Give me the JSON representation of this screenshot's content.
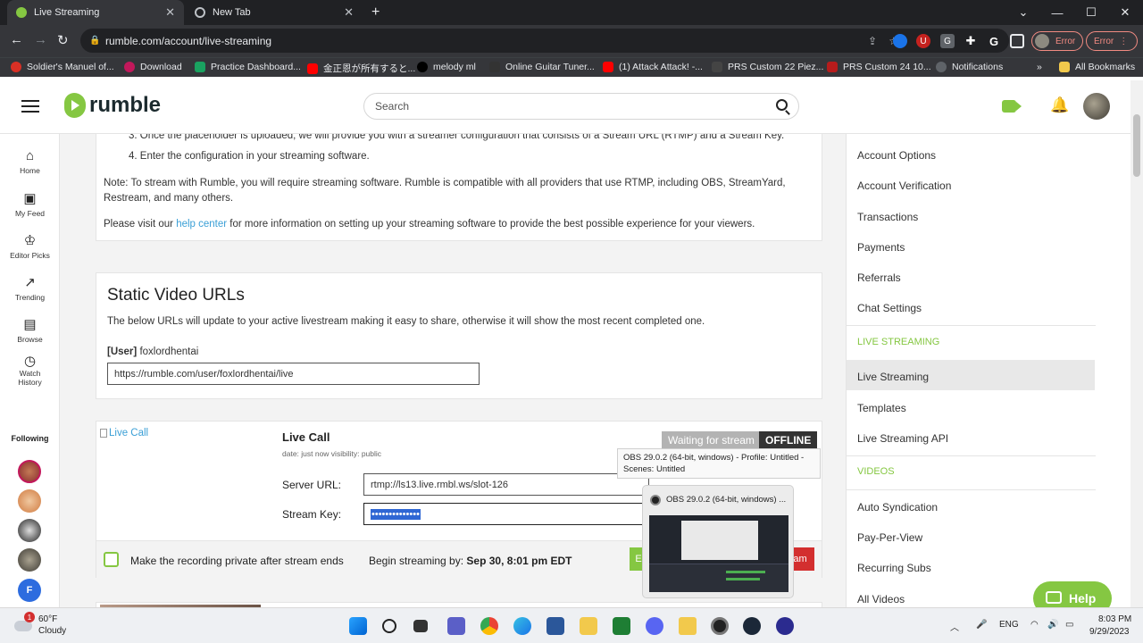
{
  "browser": {
    "tabs": [
      {
        "title": "Live Streaming"
      },
      {
        "title": "New Tab"
      }
    ],
    "new_tab_symbol": "+",
    "close_symbol": "✕",
    "url": "rumble.com/account/live-streaming",
    "extensions": {
      "error_label": "Error",
      "error_pill": "Error"
    },
    "bookmarks": [
      {
        "label": "Soldier's Manuel of...",
        "color": "#d93025"
      },
      {
        "label": "Download",
        "color": "#c2185b"
      },
      {
        "label": "Practice Dashboard...",
        "color": "#1aa260"
      },
      {
        "label": "金正恩が所有すると...",
        "color": "#ff0000"
      },
      {
        "label": "melody ml",
        "color": "#000000"
      },
      {
        "label": "Online Guitar Tuner...",
        "color": "#333333"
      },
      {
        "label": "(1) Attack Attack! -...",
        "color": "#ff0000"
      },
      {
        "label": "PRS Custom 22 Piez...",
        "color": "#444444"
      },
      {
        "label": "PRS Custom 24 10...",
        "color": "#b71c1c"
      },
      {
        "label": "Notifications",
        "color": "#5f6368"
      }
    ],
    "bookmarks_overflow": "»",
    "all_bookmarks": "All Bookmarks"
  },
  "site": {
    "logo_text": "rumble",
    "search_placeholder": "Search",
    "brand_color": "#85c742"
  },
  "leftnav": {
    "items": [
      {
        "label": "Home",
        "icon": "home-icon",
        "glyph": "⌂"
      },
      {
        "label": "My Feed",
        "icon": "feed-icon",
        "glyph": "▣"
      },
      {
        "label": "Editor Picks",
        "icon": "award-icon",
        "glyph": "♔"
      },
      {
        "label": "Trending",
        "icon": "trending-icon",
        "glyph": "↗"
      },
      {
        "label": "Browse",
        "icon": "browse-icon",
        "glyph": "▤"
      },
      {
        "label": "Watch History",
        "icon": "history-icon",
        "glyph": "◷"
      }
    ],
    "following_label": "Following",
    "following_letter": "F"
  },
  "content": {
    "steps": [
      "3. Once the placeholder is uploaded, we will provide you with a streamer configuration that consists of a Stream URL (RTMP) and a Stream Key.",
      "4. Enter the configuration in your streaming software."
    ],
    "note": "Note: To stream with Rumble, you will require streaming software. Rumble is compatible with all providers that use RTMP, including OBS, StreamYard, Restream, and many others.",
    "visit_prefix": "Please visit our ",
    "visit_link": "help center",
    "visit_suffix": " for more information on setting up your streaming software to provide the best possible experience for your viewers.",
    "static_title": "Static Video URLs",
    "static_desc": "The below URLs will update to your active livestream making it easy to share, otherwise it will show the most recent completed one.",
    "user_tag": "[User]",
    "user_name": "foxlordhentai",
    "user_url": "https://rumble.com/user/foxlordhentai/live",
    "live_call": {
      "thumb_alt": "Live Call",
      "title": "Live Call",
      "meta": "date: just now  visibility: public",
      "waiting": "Waiting for stream",
      "offline": "OFFLINE",
      "server_label": "Server URL:",
      "server_value": "rtmp://ls13.live.rmbl.ws/slot-126",
      "key_label": "Stream Key:",
      "key_value": "••••••••••••••",
      "private_label": "Make the recording private after stream ends",
      "begin_label": "Begin streaming by:",
      "begin_value": "Sep 30, 8:01 pm EDT",
      "green_btn_fragment": "E",
      "red_btn_fragment": "am"
    }
  },
  "rightnav": {
    "items": [
      "Account Options",
      "Account Verification",
      "Transactions",
      "Payments",
      "Referrals",
      "Chat Settings"
    ],
    "section_live": "LIVE STREAMING",
    "live_items": [
      "Live Streaming",
      "Templates",
      "Live Streaming API"
    ],
    "section_videos": "VIDEOS",
    "video_items": [
      "Auto Syndication",
      "Pay-Per-View",
      "Recurring Subs",
      "All Videos"
    ]
  },
  "obs": {
    "tooltip": "OBS 29.0.2 (64-bit, windows) - Profile: Untitled - Scenes: Untitled",
    "preview_title": "OBS 29.0.2 (64-bit, windows) ..."
  },
  "help_label": "Help",
  "taskbar": {
    "weather_temp": "60°F",
    "weather_desc": "Cloudy",
    "weather_badge": "1",
    "lang": "ENG",
    "time": "8:03 PM",
    "date": "9/29/2023"
  }
}
